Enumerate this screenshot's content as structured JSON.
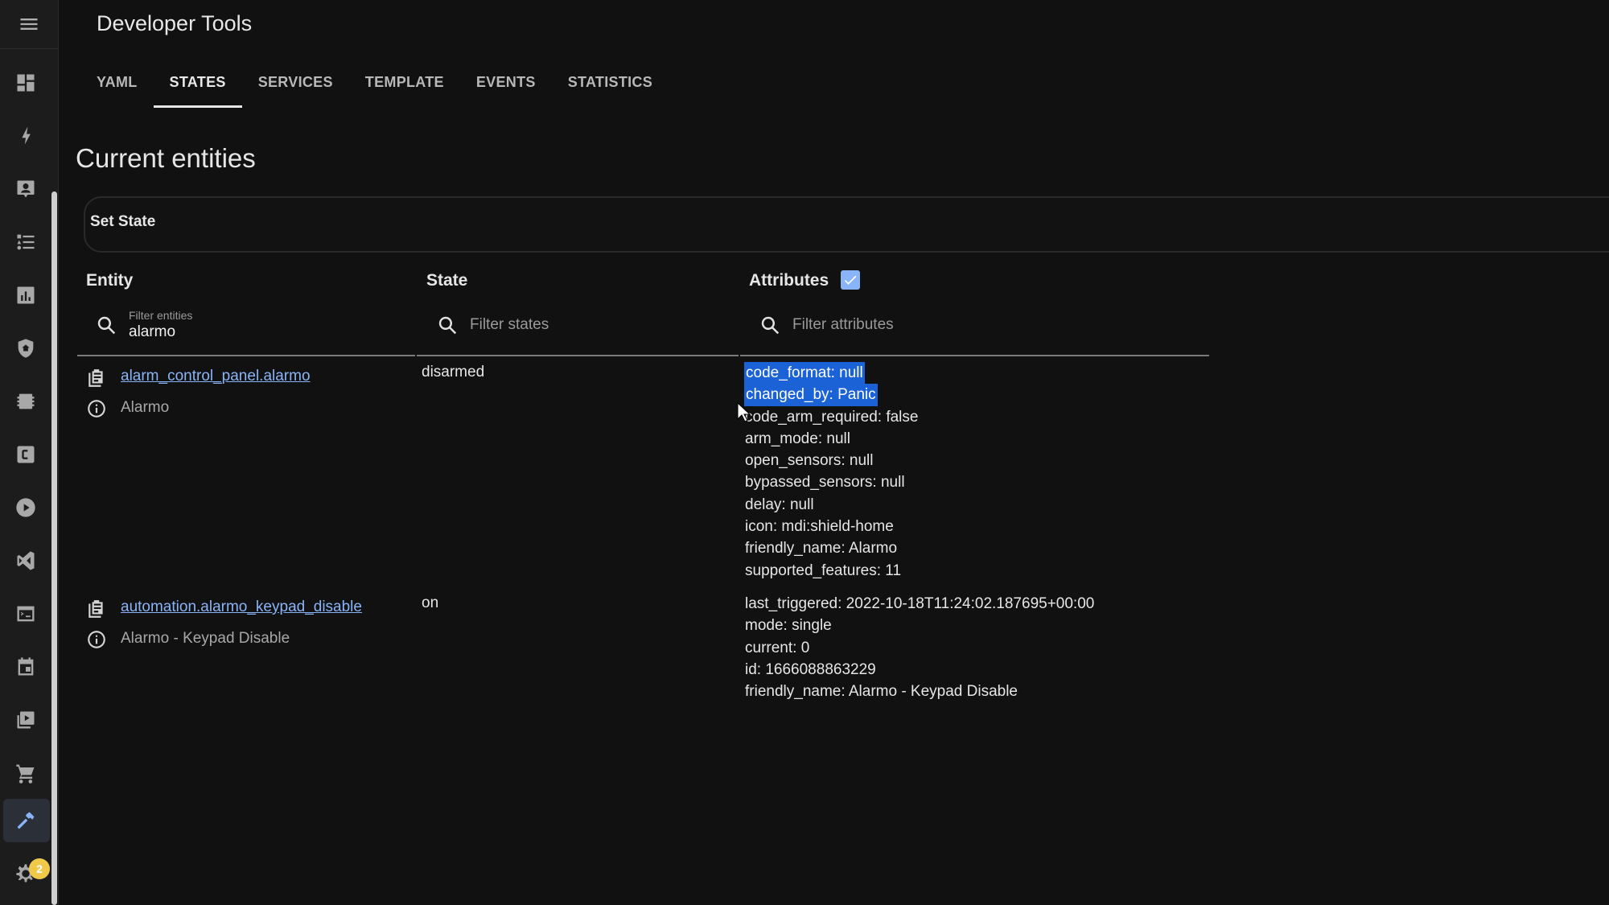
{
  "app": {
    "title": "Developer Tools"
  },
  "sidebar": {
    "items": [
      {
        "icon": "menu-icon"
      },
      {
        "icon": "dashboard-icon"
      },
      {
        "icon": "energy-icon"
      },
      {
        "icon": "person-badge-icon"
      },
      {
        "icon": "list-icon"
      },
      {
        "icon": "history-chart-icon"
      },
      {
        "icon": "shield-home-icon"
      },
      {
        "icon": "chip-icon"
      },
      {
        "icon": "c-box-icon"
      },
      {
        "icon": "play-circle-icon"
      },
      {
        "icon": "vscode-icon"
      },
      {
        "icon": "terminal-icon"
      },
      {
        "icon": "calendar-icon"
      },
      {
        "icon": "media-icon"
      },
      {
        "icon": "cart-icon"
      },
      {
        "icon": "hammer-icon",
        "active": true
      },
      {
        "icon": "gear-icon"
      }
    ],
    "settings_badge": "2"
  },
  "tabs": [
    {
      "label": "YAML"
    },
    {
      "label": "STATES",
      "active": true
    },
    {
      "label": "SERVICES"
    },
    {
      "label": "TEMPLATE"
    },
    {
      "label": "EVENTS"
    },
    {
      "label": "STATISTICS"
    }
  ],
  "main": {
    "heading": "Current entities",
    "set_state_label": "Set State",
    "columns": {
      "entity": "Entity",
      "state": "State",
      "attributes": "Attributes",
      "attributes_checked": true
    },
    "filters": {
      "entity": {
        "label": "Filter entities",
        "value": "alarmo"
      },
      "state": {
        "placeholder": "Filter states"
      },
      "attributes": {
        "placeholder": "Filter attributes"
      }
    },
    "rows": [
      {
        "entity_id": "alarm_control_panel.alarmo",
        "friendly_name": "Alarmo",
        "state": "disarmed",
        "attributes": [
          "code_format: null",
          "changed_by: Panic",
          "code_arm_required: false",
          "arm_mode: null",
          "open_sensors: null",
          "bypassed_sensors: null",
          "delay: null",
          "icon: mdi:shield-home",
          "friendly_name: Alarmo",
          "supported_features: 11"
        ],
        "selected_attribute_lines": 2
      },
      {
        "entity_id": "automation.alarmo_keypad_disable",
        "friendly_name": "Alarmo - Keypad Disable",
        "state": "on",
        "attributes": [
          "last_triggered: 2022-10-18T11:24:02.187695+00:00",
          "mode: single",
          "current: 0",
          "id: 1666088863229",
          "friendly_name: Alarmo - Keypad Disable"
        ]
      }
    ]
  },
  "colors": {
    "link": "#8ab4f8",
    "selection": "#1a62d6",
    "badge": "#f0c94b",
    "background": "#111111"
  }
}
